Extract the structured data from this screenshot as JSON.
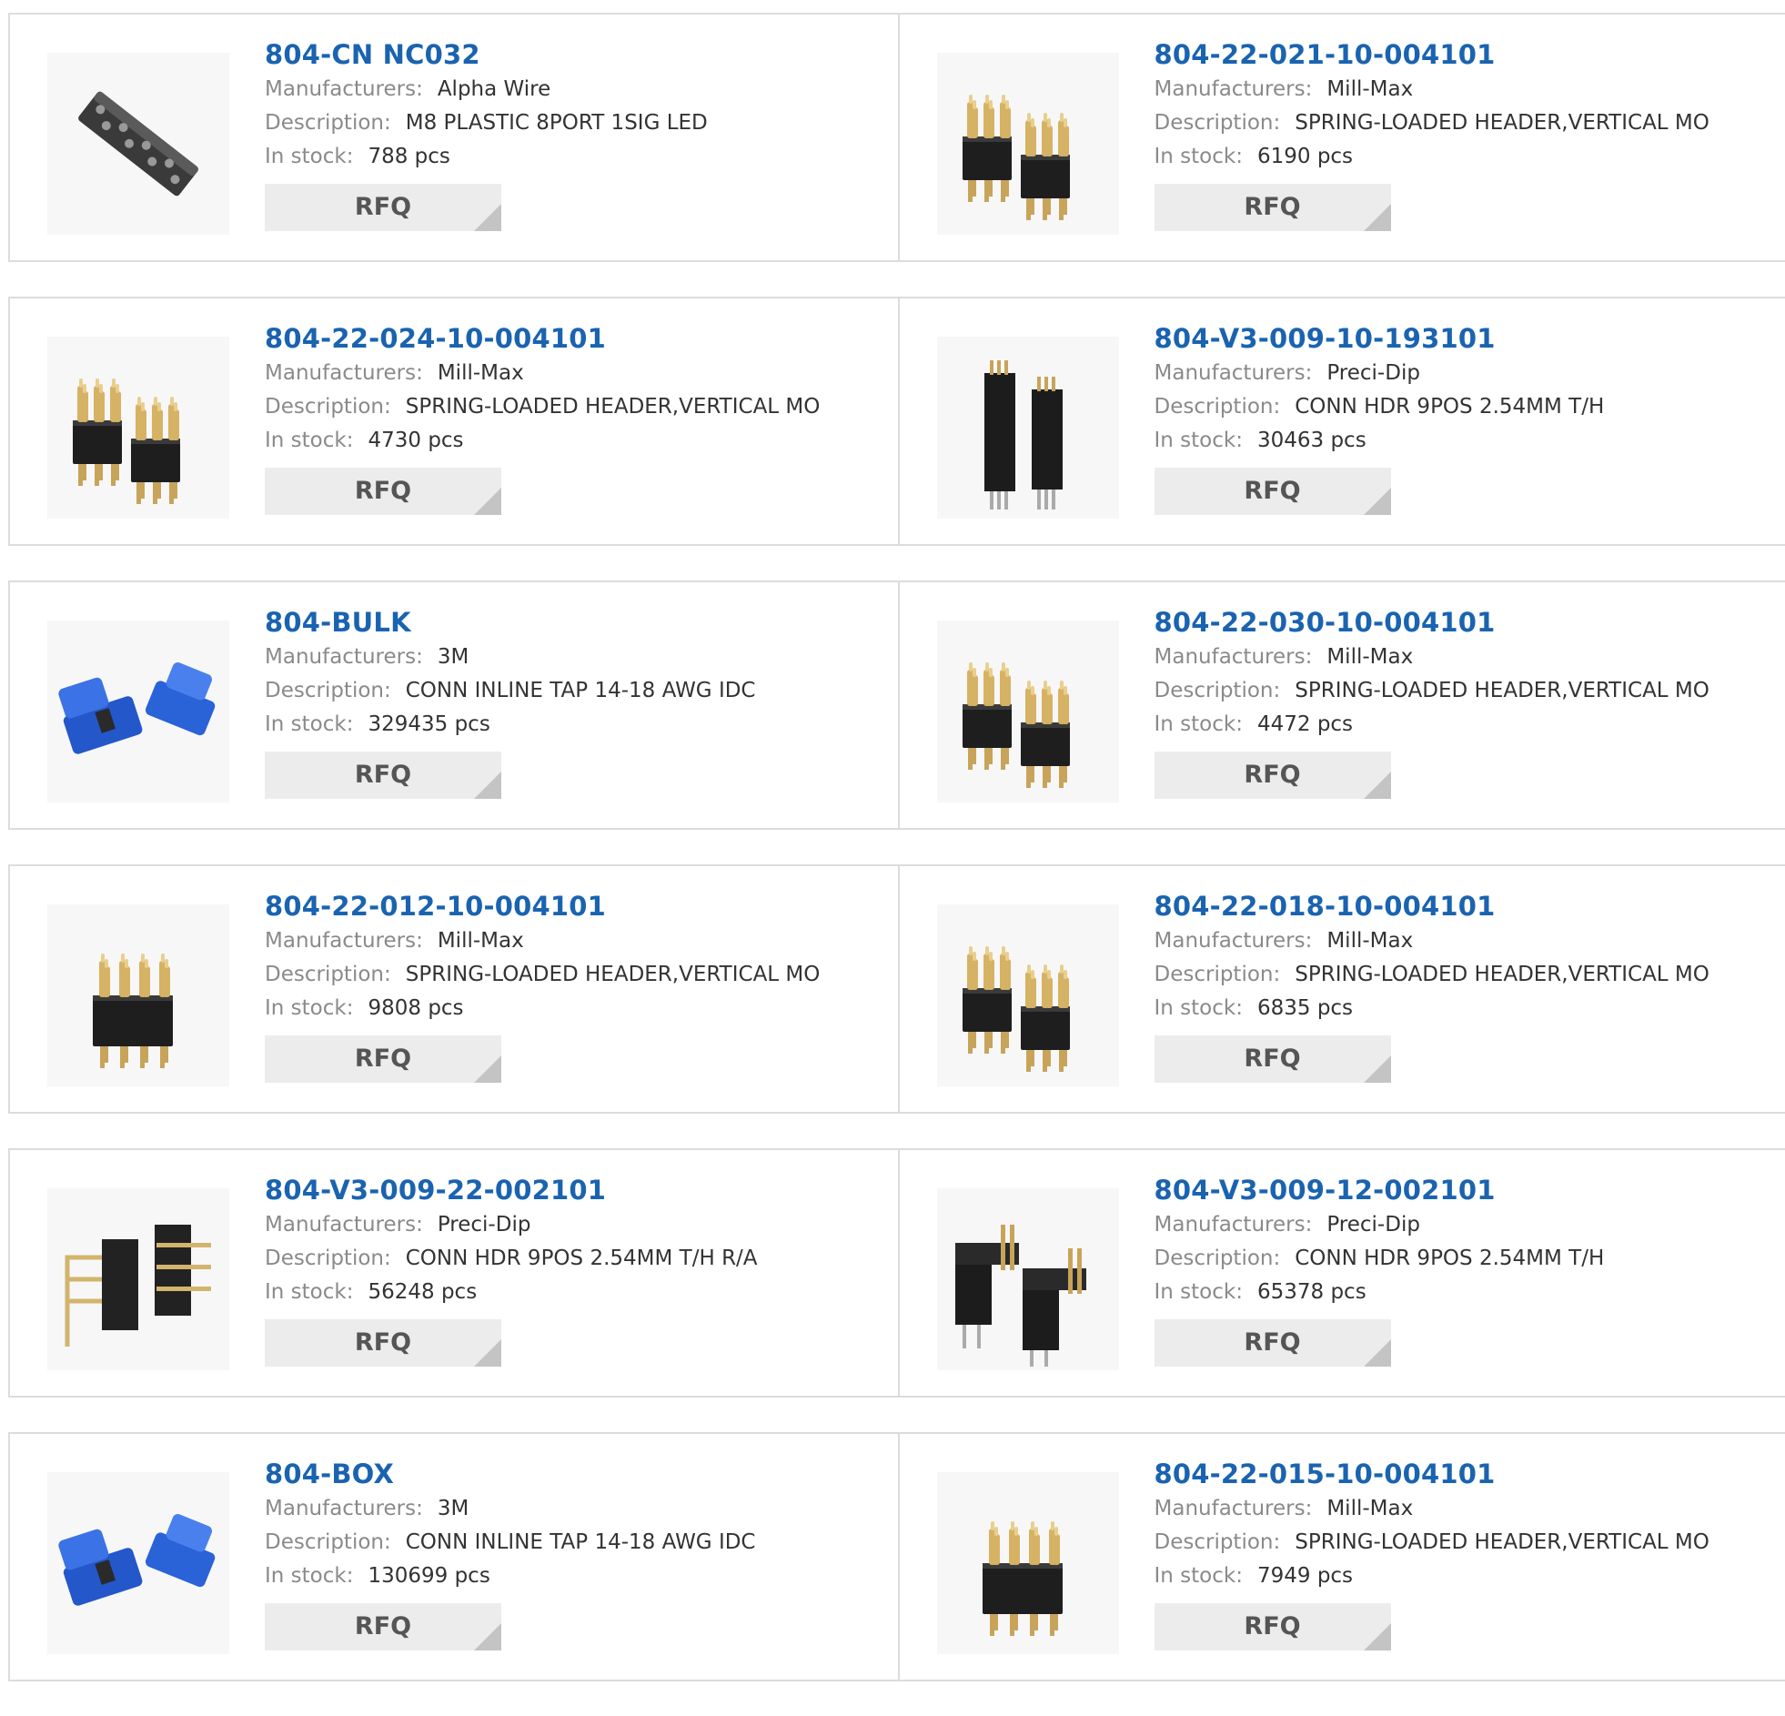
{
  "labels": {
    "manufacturer": "Manufacturers:",
    "description": "Description:",
    "stock": "In stock:",
    "rfq": "RFQ"
  },
  "products": [
    {
      "part": "804-CN NC032",
      "manufacturer": "Alpha Wire",
      "description": "M8 PLASTIC 8PORT 1SIG LED",
      "stock": "788 pcs",
      "image": "sensor-distribution-box"
    },
    {
      "part": "804-22-021-10-004101",
      "manufacturer": "Mill-Max",
      "description": "SPRING-LOADED HEADER,VERTICAL MO",
      "stock": "6190 pcs",
      "image": "spring-header-pair"
    },
    {
      "part": "804-22-024-10-004101",
      "manufacturer": "Mill-Max",
      "description": "SPRING-LOADED HEADER,VERTICAL MO",
      "stock": "4730 pcs",
      "image": "spring-header-pair"
    },
    {
      "part": "804-V3-009-10-193101",
      "manufacturer": "Preci-Dip",
      "description": "CONN HDR 9POS 2.54MM T/H",
      "stock": "30463 pcs",
      "image": "tall-header-pair"
    },
    {
      "part": "804-BULK",
      "manufacturer": "3M",
      "description": "CONN INLINE TAP 14-18 AWG IDC",
      "stock": "329435 pcs",
      "image": "blue-idc-tap"
    },
    {
      "part": "804-22-030-10-004101",
      "manufacturer": "Mill-Max",
      "description": "SPRING-LOADED HEADER,VERTICAL MO",
      "stock": "4472 pcs",
      "image": "spring-header-pair"
    },
    {
      "part": "804-22-012-10-004101",
      "manufacturer": "Mill-Max",
      "description": "SPRING-LOADED HEADER,VERTICAL MO",
      "stock": "9808 pcs",
      "image": "spring-header-single"
    },
    {
      "part": "804-22-018-10-004101",
      "manufacturer": "Mill-Max",
      "description": "SPRING-LOADED HEADER,VERTICAL MO",
      "stock": "6835 pcs",
      "image": "spring-header-pair"
    },
    {
      "part": "804-V3-009-22-002101",
      "manufacturer": "Preci-Dip",
      "description": "CONN HDR 9POS 2.54MM T/H R/A",
      "stock": "56248 pcs",
      "image": "right-angle-header-pair"
    },
    {
      "part": "804-V3-009-12-002101",
      "manufacturer": "Preci-Dip",
      "description": "CONN HDR 9POS 2.54MM T/H",
      "stock": "65378 pcs",
      "image": "header-pair-short"
    },
    {
      "part": "804-BOX",
      "manufacturer": "3M",
      "description": "CONN INLINE TAP 14-18 AWG IDC",
      "stock": "130699 pcs",
      "image": "blue-idc-tap"
    },
    {
      "part": "804-22-015-10-004101",
      "manufacturer": "Mill-Max",
      "description": "SPRING-LOADED HEADER,VERTICAL MO",
      "stock": "7949 pcs",
      "image": "spring-header-single"
    }
  ]
}
